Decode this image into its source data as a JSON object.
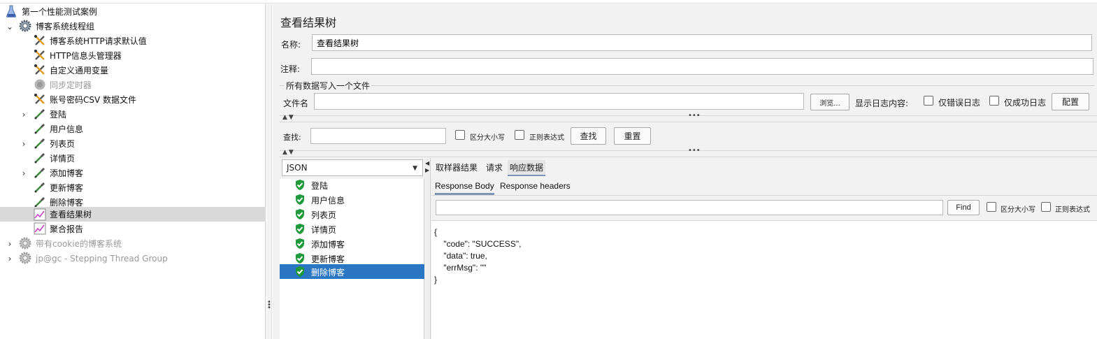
{
  "tree": {
    "items": [
      {
        "label": "第一个性能测试案例",
        "icon": "flask-icon",
        "disabled": false
      },
      {
        "label": "博客系统线程组",
        "icon": "gear-icon",
        "disabled": false
      },
      {
        "label": "博客系统HTTP请求默认值",
        "icon": "scissors-wrench-icon",
        "disabled": false
      },
      {
        "label": "HTTP信息头管理器",
        "icon": "scissors-wrench-icon",
        "disabled": false
      },
      {
        "label": "自定义通用变量",
        "icon": "scissors-wrench-icon",
        "disabled": false
      },
      {
        "label": "同步定时器",
        "icon": "timer-icon",
        "disabled": true
      },
      {
        "label": "账号密码CSV 数据文件",
        "icon": "scissors-wrench-icon",
        "disabled": false
      },
      {
        "label": "登陆",
        "icon": "pipette-icon",
        "disabled": false
      },
      {
        "label": "用户信息",
        "icon": "pipette-icon",
        "disabled": false
      },
      {
        "label": "列表页",
        "icon": "pipette-icon",
        "disabled": false
      },
      {
        "label": "详情页",
        "icon": "pipette-icon",
        "disabled": false
      },
      {
        "label": "添加博客",
        "icon": "pipette-icon",
        "disabled": false
      },
      {
        "label": "更新博客",
        "icon": "pipette-icon",
        "disabled": false
      },
      {
        "label": "删除博客",
        "icon": "pipette-icon",
        "disabled": false
      },
      {
        "label": "查看结果树",
        "icon": "chart-line-icon",
        "disabled": false
      },
      {
        "label": "聚合报告",
        "icon": "chart-line-icon",
        "disabled": false
      },
      {
        "label": "带有cookie的博客系统",
        "icon": "gear-icon",
        "disabled": true
      },
      {
        "label": "jp@gc - Stepping Thread Group",
        "icon": "gear-icon",
        "disabled": true
      }
    ],
    "selected": "查看结果树"
  },
  "panel": {
    "title": "查看结果树",
    "name_label": "名称:",
    "name_value": "查看结果树",
    "comment_label": "注释:",
    "comment_value": "",
    "file_group_title": "所有数据写入一个文件",
    "filename_label": "文件名",
    "filename_value": "",
    "browse_button": "浏览...",
    "log_display_label": "显示日志内容:",
    "errors_only_label": "仅错误日志",
    "success_only_label": "仅成功日志",
    "configure_button": "配置",
    "search_label": "查找:",
    "search_value": "",
    "case_sensitive_label": "区分大小写",
    "regex_label": "正则表达式",
    "find_button": "查找",
    "reset_button": "重置"
  },
  "results": {
    "renderer": "JSON",
    "samples": [
      "登陆",
      "用户信息",
      "列表页",
      "详情页",
      "添加博客",
      "更新博客",
      "删除博客"
    ],
    "selected_sample": "删除博客",
    "tabs": [
      "取样器结果",
      "请求",
      "响应数据"
    ],
    "active_tab": "响应数据",
    "subtabs": [
      "Response Body",
      "Response headers"
    ],
    "active_subtab": "Response Body",
    "find_value": "",
    "find_button": "Find",
    "case_sensitive_label": "区分大小写",
    "regex_label": "正则表达式",
    "response_body": "{\n    \"code\": \"SUCCESS\",\n    \"data\": true,\n    \"errMsg\": \"\"\n}"
  },
  "colors": {
    "selection_blue": "#2b76c2",
    "success_green": "#1e9a3a",
    "tab_underline": "#7f95b7"
  }
}
